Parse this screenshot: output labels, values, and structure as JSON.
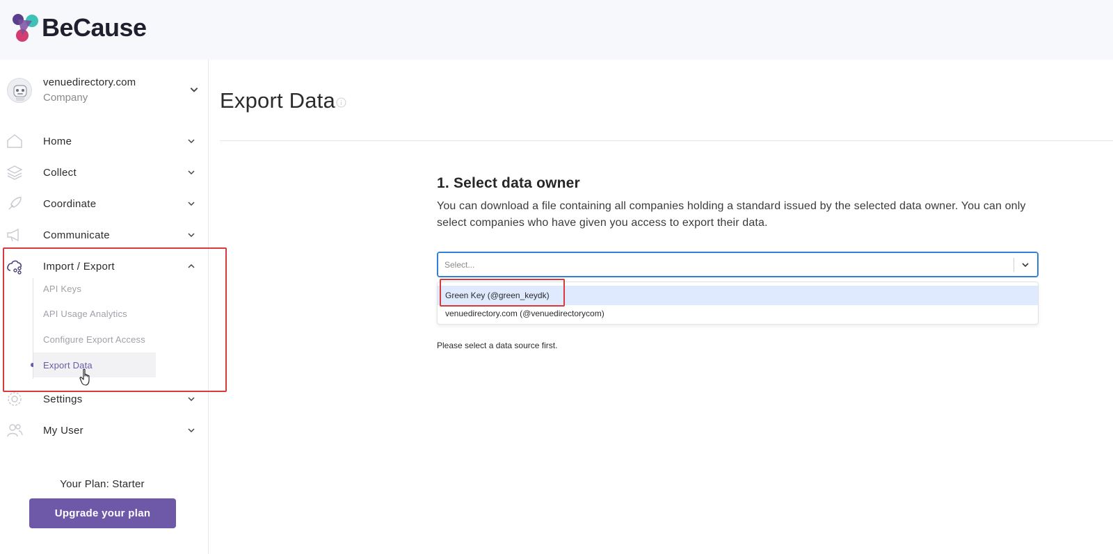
{
  "brand": {
    "name": "BeCause"
  },
  "company": {
    "name": "venuedirectory.com",
    "type": "Company"
  },
  "nav": {
    "home": "Home",
    "collect": "Collect",
    "coordinate": "Coordinate",
    "communicate": "Communicate",
    "import_export": "Import / Export",
    "settings": "Settings",
    "my_user": "My User"
  },
  "subnav": {
    "api_keys": "API Keys",
    "api_usage": "API Usage Analytics",
    "configure_export": "Configure Export Access",
    "export_data": "Export Data"
  },
  "plan": {
    "text": "Your Plan: Starter",
    "upgrade_label": "Upgrade your plan"
  },
  "page": {
    "title": "Export Data"
  },
  "step": {
    "title": "1. Select data owner",
    "description": "You can download a file containing all companies holding a standard issued by the selected data owner. You can only select companies who have given you access to export their data."
  },
  "select": {
    "placeholder": "Select...",
    "options": [
      "Green Key (@green_keydk)",
      "venuedirectory.com (@venuedirectorycom)"
    ]
  },
  "hint": "Please select a data source first.",
  "colors": {
    "accent": "#6e59a8",
    "focus": "#2f7ed8",
    "highlight": "#d9383d"
  }
}
